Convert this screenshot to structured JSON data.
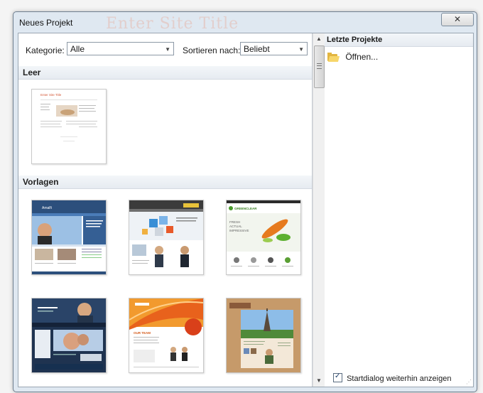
{
  "window": {
    "title": "Neues Projekt",
    "close_glyph": "✕",
    "ghost_title": "Enter Site Title"
  },
  "toolbar": {
    "category_label": "Kategorie:",
    "category_value": "Alle",
    "sort_label": "Sortieren nach:",
    "sort_value": "Beliebt"
  },
  "sections": {
    "empty": "Leer",
    "templates": "Vorlagen"
  },
  "blank_template": {
    "title": "Enter Site Title"
  },
  "templates": [
    {
      "name": "template-business-blue",
      "accent": "#3b6fa8"
    },
    {
      "name": "template-cubes",
      "accent": "#e8c23a"
    },
    {
      "name": "template-greenclear",
      "accent": "#4a9a2c",
      "brand": "GREENCLEAR",
      "tagline": [
        "FRESH",
        "ACTUAL",
        "IMPRESSIVE"
      ]
    },
    {
      "name": "template-dark-blue",
      "accent": "#1f3350"
    },
    {
      "name": "template-orange-team",
      "accent": "#e8621c",
      "heading": "OUR TEAM"
    },
    {
      "name": "template-paris",
      "accent": "#c69a6a"
    }
  ],
  "recent": {
    "header": "Letzte Projekte",
    "open_label": "Öffnen..."
  },
  "footer": {
    "startdialog_label": "Startdialog weiterhin anzeigen",
    "startdialog_checked": true
  },
  "icons": {
    "folder": "folder-open-icon",
    "scroll_up": "▲",
    "scroll_down": "▼",
    "dropdown": "▼"
  }
}
